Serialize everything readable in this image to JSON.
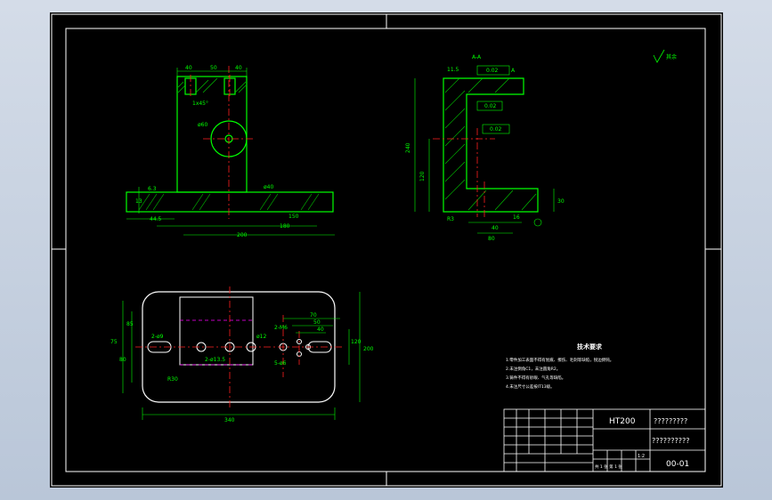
{
  "colors": {
    "background": "#000000",
    "frame": "#ffffff",
    "part": "#00ff00",
    "dimension": "#00ff00",
    "centerline": "#ff2020",
    "hidden": "#ff00ff",
    "text": "#ffffff",
    "hatch": "#00cc00"
  },
  "front_view": {
    "top_dims": [
      "40",
      "50",
      "40"
    ],
    "chamfer": "1x45°",
    "bore": "ø60",
    "slot_dim": "ø40",
    "bottom_dims": [
      "200",
      "180",
      "150",
      "44.5"
    ],
    "left_dims": [
      "6.3",
      "13"
    ]
  },
  "side_view": {
    "section_label": "A-A",
    "height_dims": [
      "240",
      "120"
    ],
    "right_dim": "30",
    "top_dims": [
      "11.5",
      "0.02",
      "0.02",
      "0.02"
    ],
    "bottom_dims": [
      "80",
      "40",
      "16",
      "R3"
    ],
    "datum": "A"
  },
  "plan_view": {
    "width_dim": "340",
    "right_dims": [
      "200",
      "120"
    ],
    "left_dims": [
      "75",
      "85",
      "80"
    ],
    "hole_labels": [
      "2-ø9",
      "2-ø13.5",
      "2-M6",
      "5-ø6",
      "ø12"
    ],
    "small_dims": [
      "70",
      "50",
      "40"
    ],
    "radius": "R30"
  },
  "notes": {
    "title": "技术要求",
    "lines": [
      "1.零件加工表面不得有划痕、擦伤、毛刺等缺陷，锐边倒钝。",
      "2.未注倒角C1，未注圆角R2。",
      "3.铸件不得有砂眼、气孔等缺陷。",
      "4.未注尺寸公差按IT13级。"
    ]
  },
  "roughness_symbol": "其余",
  "title_block": {
    "material": "HT200",
    "part_name": "?????????",
    "company": "??????????",
    "drawing_no": "00-01",
    "scale": "1:2",
    "sheet_row": "共 1 张   第 1 张"
  }
}
